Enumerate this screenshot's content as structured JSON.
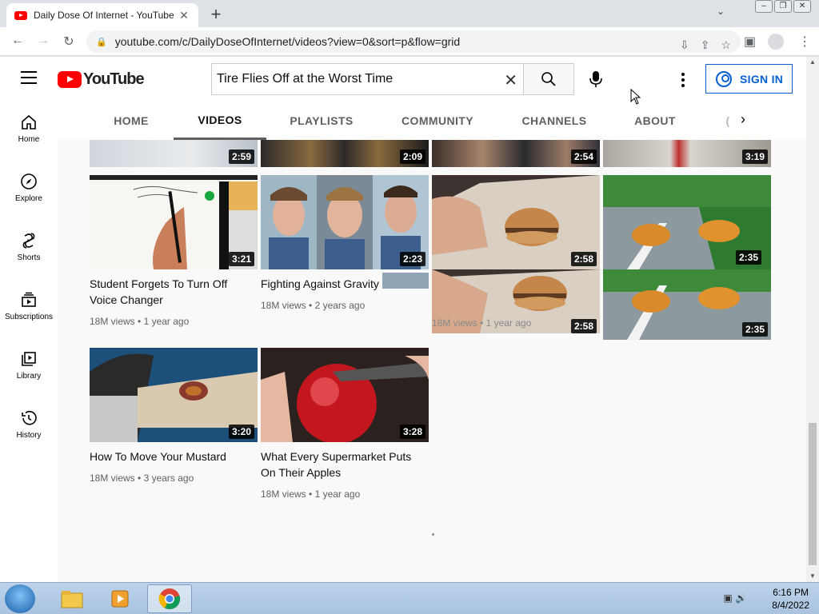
{
  "browser": {
    "tab_title": "Daily Dose Of Internet - YouTube",
    "url": "youtube.com/c/DailyDoseOfInternet/videos?view=0&sort=p&flow=grid"
  },
  "masthead": {
    "logo_text": "YouTube",
    "search_value": "Tire Flies Off at the Worst Time",
    "sign_in_label": "SIGN IN"
  },
  "channel_tabs": [
    "HOME",
    "VIDEOS",
    "PLAYLISTS",
    "COMMUNITY",
    "CHANNELS",
    "ABOUT",
    "("
  ],
  "guide": [
    {
      "label": "Home",
      "icon": "home-icon"
    },
    {
      "label": "Explore",
      "icon": "compass-icon"
    },
    {
      "label": "Shorts",
      "icon": "shorts-icon"
    },
    {
      "label": "Subscriptions",
      "icon": "subscriptions-icon"
    },
    {
      "label": "Library",
      "icon": "library-icon"
    },
    {
      "label": "History",
      "icon": "history-icon"
    }
  ],
  "top_row_durations": [
    "2:59",
    "2:09",
    "2:54",
    "3:19"
  ],
  "videos": [
    {
      "title": "Student Forgets To Turn Off Voice Changer",
      "views": "18M views",
      "age": "1 year ago",
      "duration": "3:21"
    },
    {
      "title": "Fighting Against Gravity",
      "views": "18M views",
      "age": "2 years ago",
      "duration": "2:23"
    },
    {
      "title": "",
      "views": "18M views",
      "age": "1 year ago",
      "duration": "2:58",
      "duration_dup": "2:58"
    },
    {
      "title": "",
      "views": "",
      "age": "",
      "duration": "2:35",
      "duration_dup": "2:35"
    },
    {
      "title": "How To Move Your Mustard",
      "views": "18M views",
      "age": "3 years ago",
      "duration": "3:20"
    },
    {
      "title": "What Every Supermarket Puts On Their Apples",
      "views": "18M views",
      "age": "1 year ago",
      "duration": "3:28"
    }
  ],
  "taskbar": {
    "time": "6:16 PM",
    "date": "8/4/2022"
  }
}
